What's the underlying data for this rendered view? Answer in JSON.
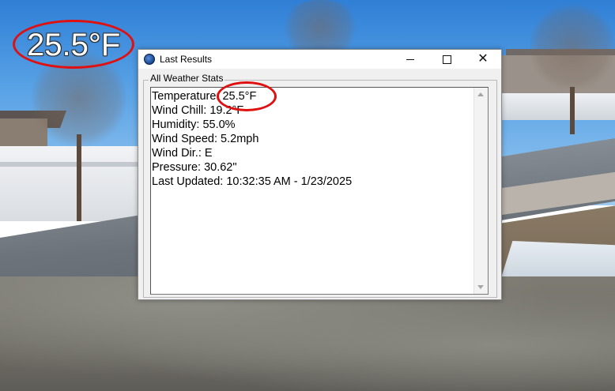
{
  "overlay": {
    "temperature": "25.5°F"
  },
  "window": {
    "title": "Last Results",
    "controls": {
      "minimize": "minimize",
      "maximize": "maximize",
      "close": "✕"
    }
  },
  "group": {
    "label": "All Weather Stats"
  },
  "stats": {
    "temperature": "Temperature: 25.5°F",
    "wind_chill": "Wind Chill: 19.2°F",
    "humidity": "Humidity: 55.0%",
    "wind_speed": "Wind Speed: 5.2mph",
    "wind_dir": "Wind Dir.: E",
    "pressure": "Pressure: 30.62\"",
    "last_updated": "Last Updated: 10:32:35 AM - 1/23/2025"
  },
  "colors": {
    "annotation_red": "#e01010",
    "window_bg": "#f0f0f0"
  },
  "icons": {
    "app": "app-globe-icon",
    "scroll_up": "scroll-up-arrow-icon",
    "scroll_down": "scroll-down-arrow-icon"
  }
}
